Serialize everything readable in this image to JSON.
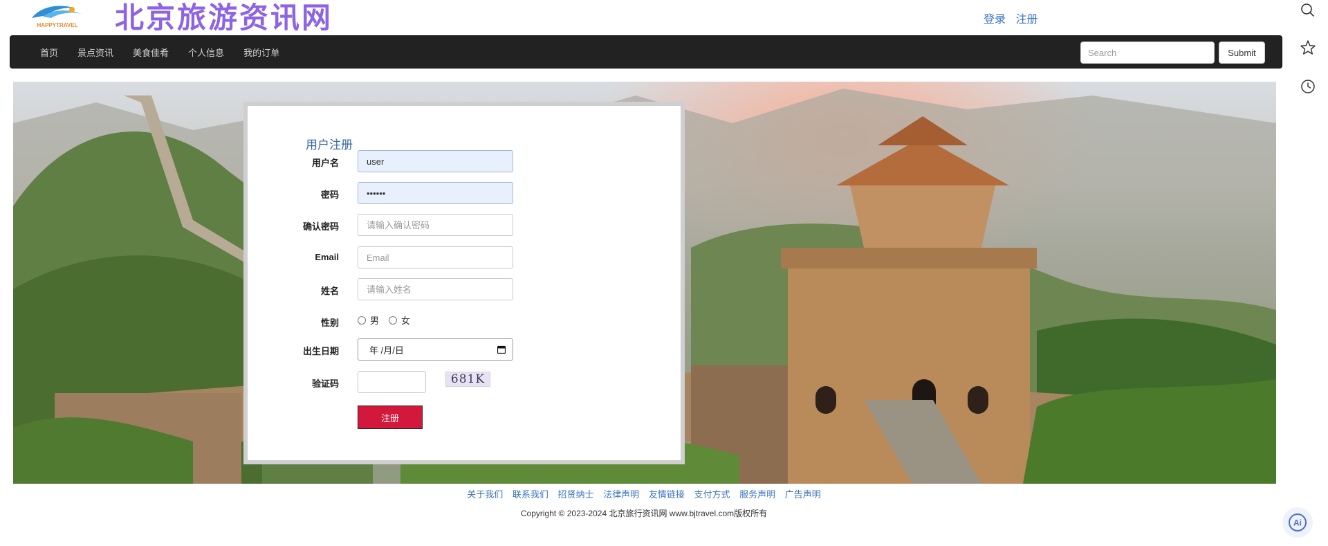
{
  "header": {
    "logo_text": "HAPPYTRAVEL",
    "site_title": "北京旅游资讯网",
    "login": "登录",
    "register": "注册"
  },
  "navbar": {
    "items": [
      "首页",
      "景点资讯",
      "美食佳肴",
      "个人信息",
      "我的订单"
    ],
    "search_placeholder": "Search",
    "submit": "Submit"
  },
  "form": {
    "title": "用户注册",
    "username": {
      "label": "用户名",
      "value": "user"
    },
    "password": {
      "label": "密码",
      "value": "••••••"
    },
    "confirm_password": {
      "label": "确认密码",
      "placeholder": "请输入确认密码"
    },
    "email": {
      "label": "Email",
      "placeholder": "Email"
    },
    "name": {
      "label": "姓名",
      "placeholder": "请输入姓名"
    },
    "gender": {
      "label": "性别",
      "options": [
        "男",
        "女"
      ]
    },
    "birthdate": {
      "label": "出生日期",
      "value": "年 /月/日"
    },
    "captcha": {
      "label": "验证码",
      "image_text": "681K"
    },
    "submit": "注册"
  },
  "footer": {
    "links": [
      "关于我们",
      "联系我们",
      "招贤纳士",
      "法律声明",
      "友情链接",
      "支付方式",
      "服务声明",
      "广告声明"
    ],
    "copyright": "Copyright © 2023-2024 北京旅行资讯网 www.bjtravel.com版权所有"
  },
  "side_rail": {
    "icons": [
      "search-icon",
      "star-icon",
      "history-icon",
      "ai-icon"
    ],
    "ai_label": "Ai"
  },
  "colors": {
    "brand_purple": "#8e64e6",
    "link_blue": "#3a73bf",
    "navbar_bg": "#222222",
    "register_red": "#d2183b"
  }
}
